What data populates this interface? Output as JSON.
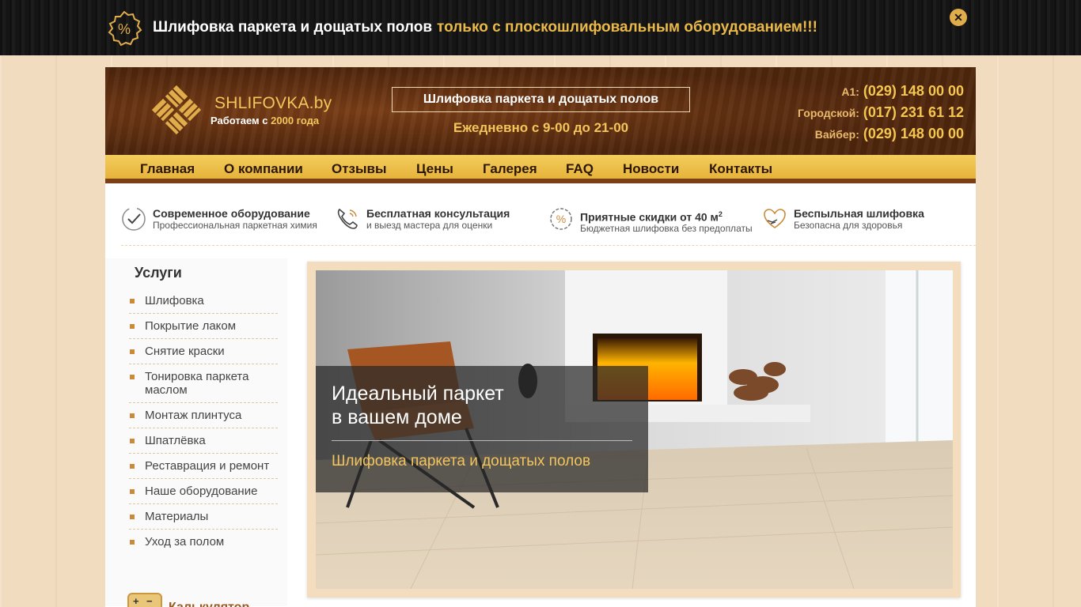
{
  "promo": {
    "text_white": "Шлифовка паркета и дощатых полов",
    "text_yellow": "только с плоскошлифовальным оборудованием!!!",
    "close": "✕"
  },
  "header": {
    "logo_name": "SHLIFOVKA",
    "logo_domain": ".by",
    "logo_sub_prefix": "Работаем с",
    "logo_sub_year": "2000 года",
    "box_text": "Шлифовка паркета и дощатых полов",
    "hours": "Ежедневно с 9-00 до 21-00",
    "phones": [
      {
        "label": "A1:",
        "number": "(029) 148 00 00"
      },
      {
        "label": "Городской:",
        "number": "(017) 231 61 12"
      },
      {
        "label": "Вайбер:",
        "number": "(029) 148 00 00"
      }
    ]
  },
  "nav": [
    "Главная",
    "О компании",
    "Отзывы",
    "Цены",
    "Галерея",
    "FAQ",
    "Новости",
    "Контакты"
  ],
  "features": [
    {
      "title": "Современное оборудование",
      "sub": "Профессиональная паркетная химия",
      "icon": "check-circle-icon"
    },
    {
      "title": "Бесплатная консультация",
      "sub": "и выезд мастера для оценки",
      "icon": "phone-icon"
    },
    {
      "title": "Приятные скидки от 40 м",
      "sup": "2",
      "sub": "Бюджетная шлифовка без предоплаты",
      "icon": "percent-badge-icon"
    },
    {
      "title": "Беспыльная шлифовка",
      "sub": "Безопасна для здоровья",
      "icon": "heart-hands-icon"
    }
  ],
  "sidebar": {
    "title": "Услуги",
    "items": [
      "Шлифовка",
      "Покрытие лаком",
      "Снятие краски",
      "Тонировка паркета маслом",
      "Монтаж плинтуса",
      "Шпатлёвка",
      "Реставрация и ремонт",
      "Наше оборудование",
      "Материалы",
      "Уход за полом"
    ],
    "calc_label": "Калькулятор"
  },
  "slider": {
    "title": "Идеальный паркет\nв вашем доме",
    "subtitle": "Шлифовка паркета и дощатых полов"
  },
  "colors": {
    "accent": "#f3c55b",
    "brown": "#5a2c0f",
    "nav": "#e6b33b"
  }
}
